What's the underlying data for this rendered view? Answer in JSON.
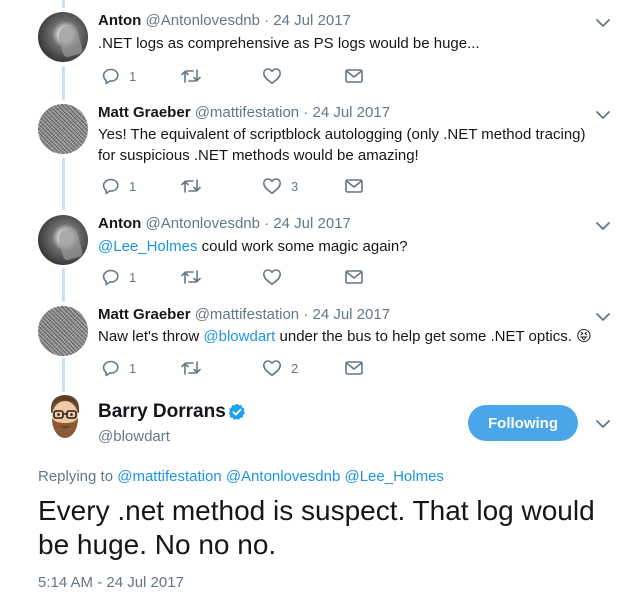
{
  "colors": {
    "link": "#1b95e0",
    "secondary_text": "#657786",
    "follow_button": "#4aa6e8",
    "thread_line": "#c4e3f7"
  },
  "replies": [
    {
      "name": "Anton",
      "handle": "@Antonlovesdnb",
      "dot": "·",
      "date": "24 Jul 2017",
      "text": ".NET logs as comprehensive as PS logs would be huge...",
      "reply_count": "1",
      "retweet_count": "",
      "like_count": ""
    },
    {
      "name": "Matt Graeber",
      "handle": "@mattifestation",
      "dot": "·",
      "date": "24 Jul 2017",
      "text": "Yes! The equivalent of scriptblock autologging (only .NET method tracing) for suspicious .NET methods would be amazing!",
      "reply_count": "1",
      "retweet_count": "",
      "like_count": "3"
    },
    {
      "name": "Anton",
      "handle": "@Antonlovesdnb",
      "dot": "·",
      "date": "24 Jul 2017",
      "mention": "@Lee_Holmes",
      "text": " could work some magic again?",
      "reply_count": "1",
      "retweet_count": "",
      "like_count": ""
    },
    {
      "name": "Matt Graeber",
      "handle": "@mattifestation",
      "dot": "·",
      "date": "24 Jul 2017",
      "text_before": "Naw let's throw ",
      "mention": "@blowdart",
      "text_after": " under the bus to help get some .NET optics. ",
      "emoji": "😝",
      "reply_count": "1",
      "retweet_count": "",
      "like_count": "2"
    }
  ],
  "main_tweet": {
    "name": "Barry Dorrans",
    "handle": "@blowdart",
    "follow_label": "Following",
    "replying_label": "Replying to ",
    "replying_mentions": [
      "@mattifestation",
      "@Antonlovesdnb",
      "@Lee_Holmes"
    ],
    "text": "Every .net method is suspect. That log would be huge. No no no.",
    "timestamp": "5:14 AM - 24 Jul 2017"
  },
  "icons": {
    "reply": "reply-icon",
    "retweet": "retweet-icon",
    "like": "heart-icon",
    "dm": "envelope-icon",
    "menu": "chevron-down-icon",
    "verified": "verified-badge-icon"
  }
}
